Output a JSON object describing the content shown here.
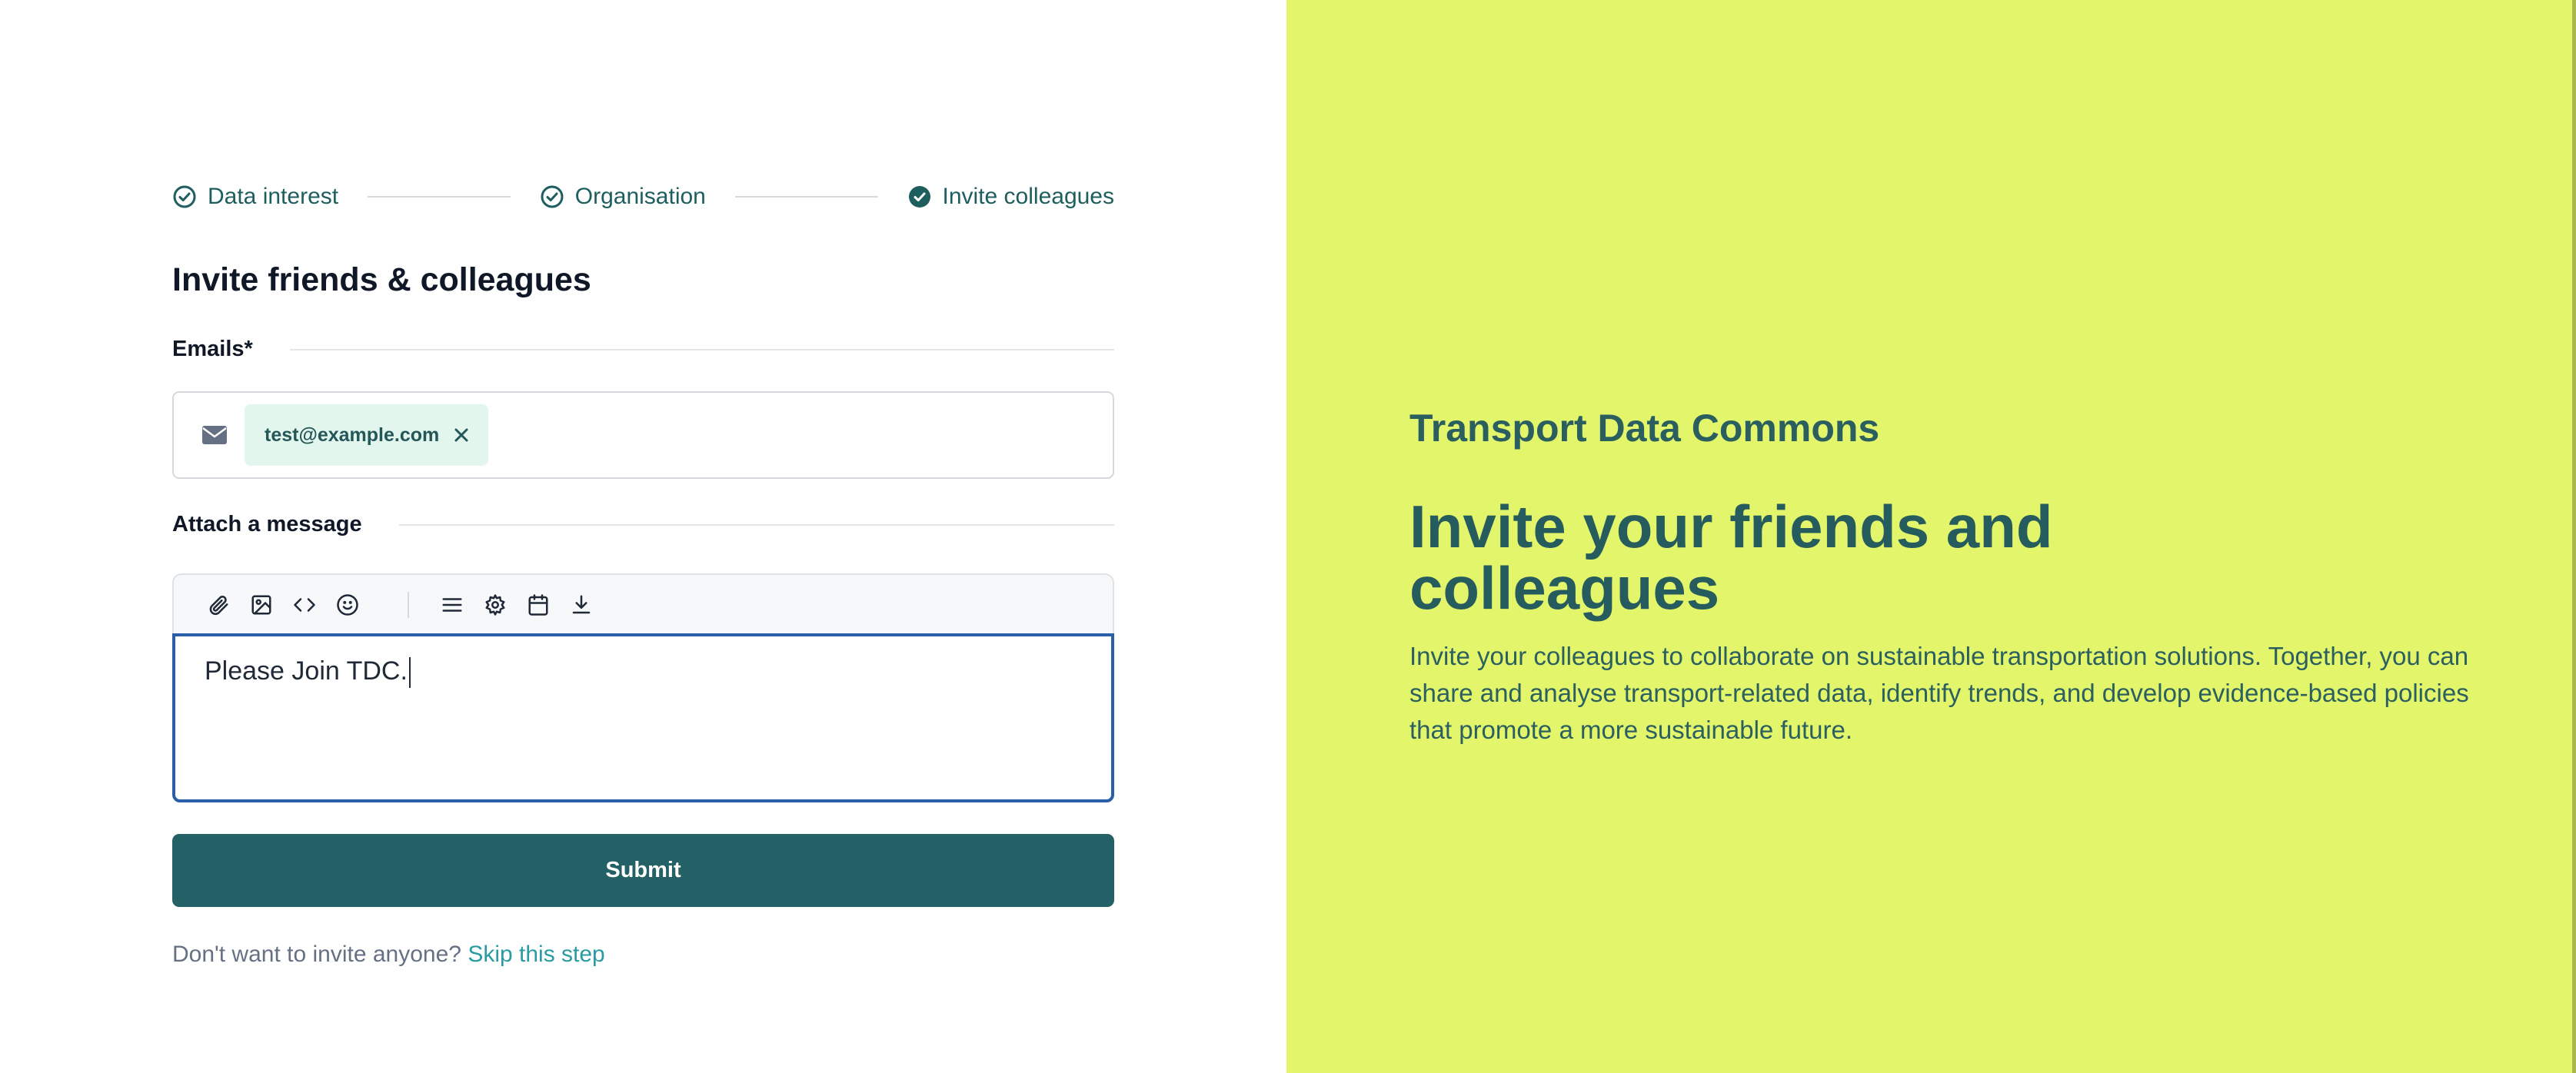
{
  "stepper": {
    "steps": [
      {
        "label": "Data interest",
        "status": "complete"
      },
      {
        "label": "Organisation",
        "status": "complete"
      },
      {
        "label": "Invite colleagues",
        "status": "current"
      }
    ]
  },
  "form": {
    "title": "Invite friends & colleagues",
    "emails_label": "Emails*",
    "email_chips": [
      "test@example.com"
    ],
    "message_label": "Attach a message",
    "toolbar_icons": [
      "paperclip-icon",
      "image-icon",
      "code-icon",
      "emoji-icon",
      "list-icon",
      "gear-icon",
      "calendar-icon",
      "download-icon"
    ],
    "message_value": "Please Join TDC.",
    "submit_label": "Submit",
    "skip_prompt": "Don't want to invite anyone?",
    "skip_link": "Skip this step"
  },
  "promo": {
    "brand": "Transport Data Commons",
    "headline": "Invite your friends and colleagues",
    "description": "Invite your colleagues to collaborate on sustainable transportation solutions. Together, you can share and analyse transport-related data, identify trends, and develop evidence-based policies that promote a more sustainable future."
  },
  "colors": {
    "primary": "#246166",
    "accent_panel": "#e3f56b",
    "link": "#2a9ba2",
    "focus_border": "#2a5ea8",
    "chip_bg": "#e3f6ee"
  }
}
